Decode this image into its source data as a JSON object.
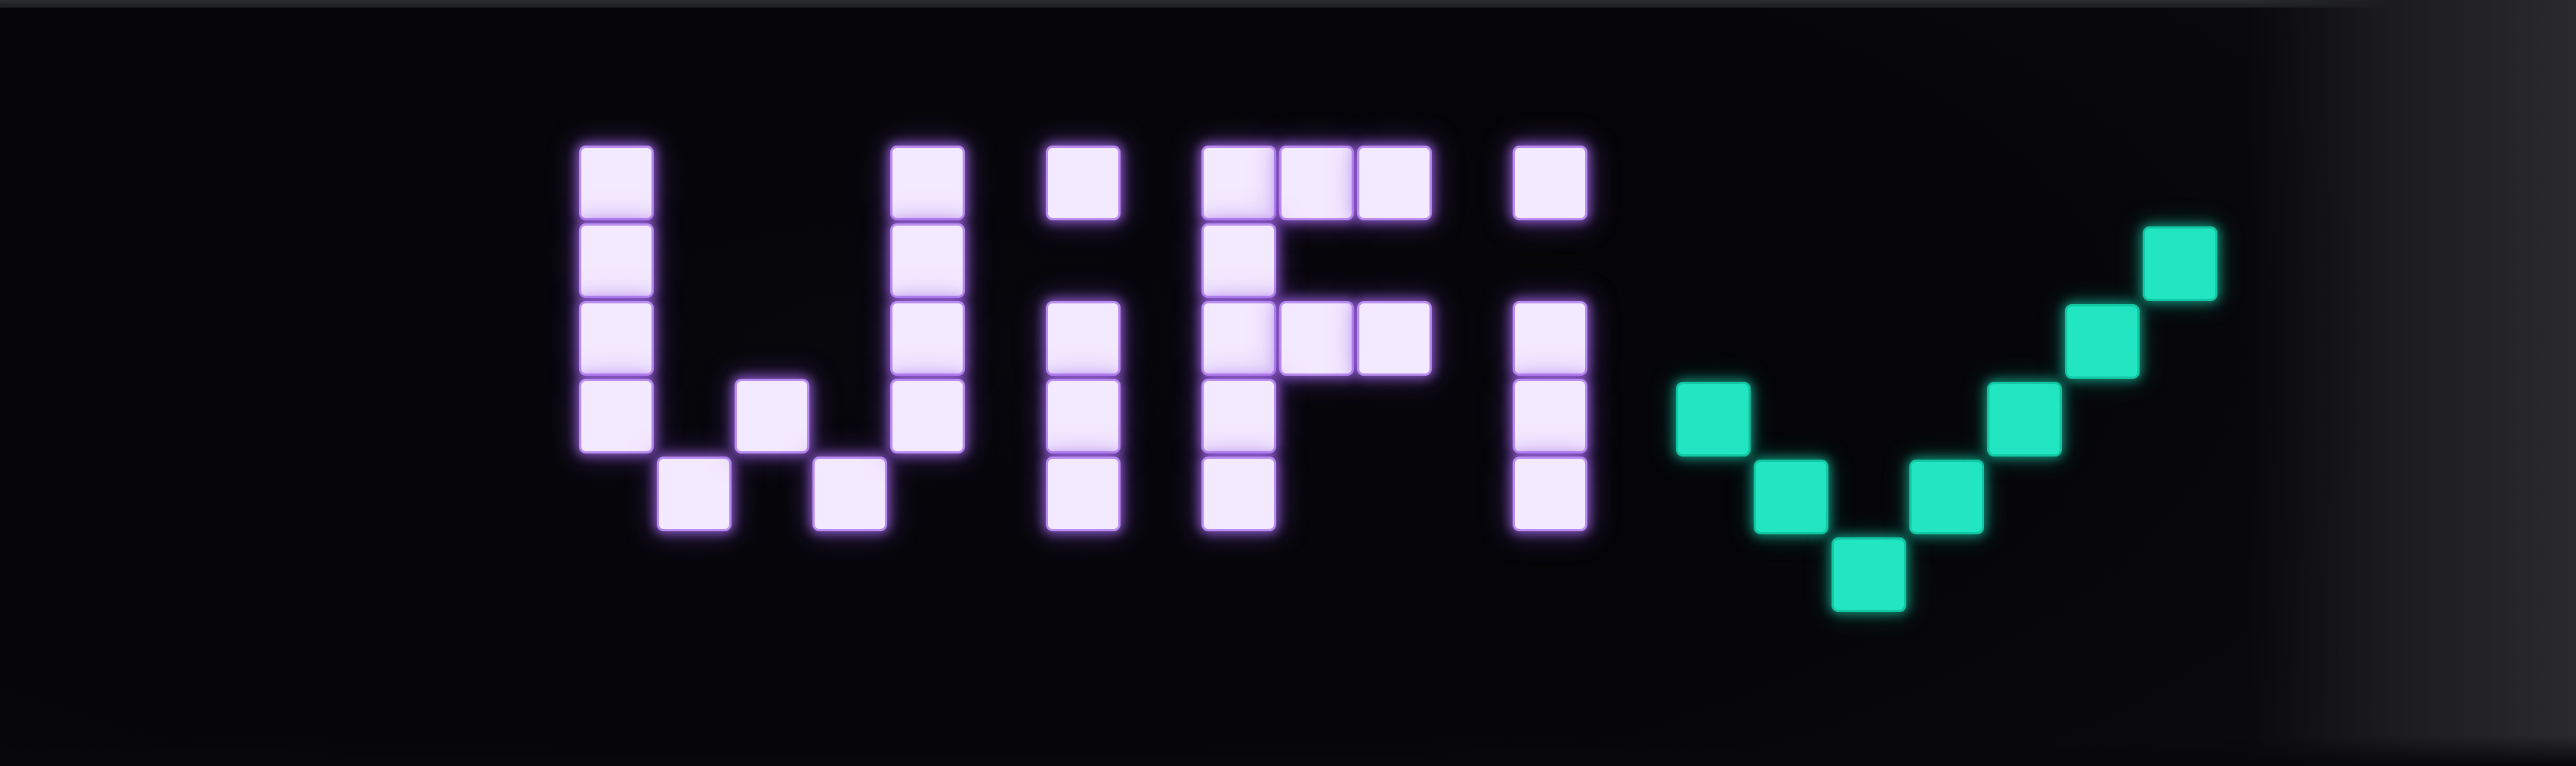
{
  "display": {
    "text": "WiFi",
    "status_icon": "check-mark-icon",
    "text_color": "#f4eaff",
    "text_glow_color": "#b98cf0",
    "icon_color": "#22e6c2",
    "background_color": "#050508"
  }
}
